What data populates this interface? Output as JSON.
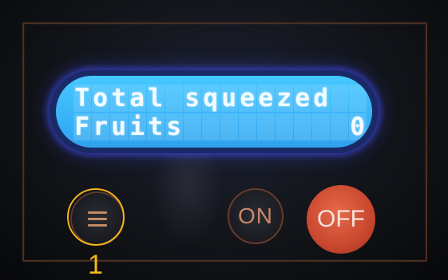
{
  "display": {
    "line1": "Total squeezed  ",
    "line2": "Fruits         0"
  },
  "buttons": {
    "on_label": "ON",
    "off_label": "OFF"
  },
  "callout": {
    "label": "1"
  },
  "colors": {
    "lcd_background": "#3ab6f8",
    "lcd_text": "#f4fbff",
    "off_button": "#c9472f",
    "callout": "#f4b51a",
    "panel_border": "#4a2f22"
  },
  "icons": {
    "menu_button": "menu-icon"
  }
}
